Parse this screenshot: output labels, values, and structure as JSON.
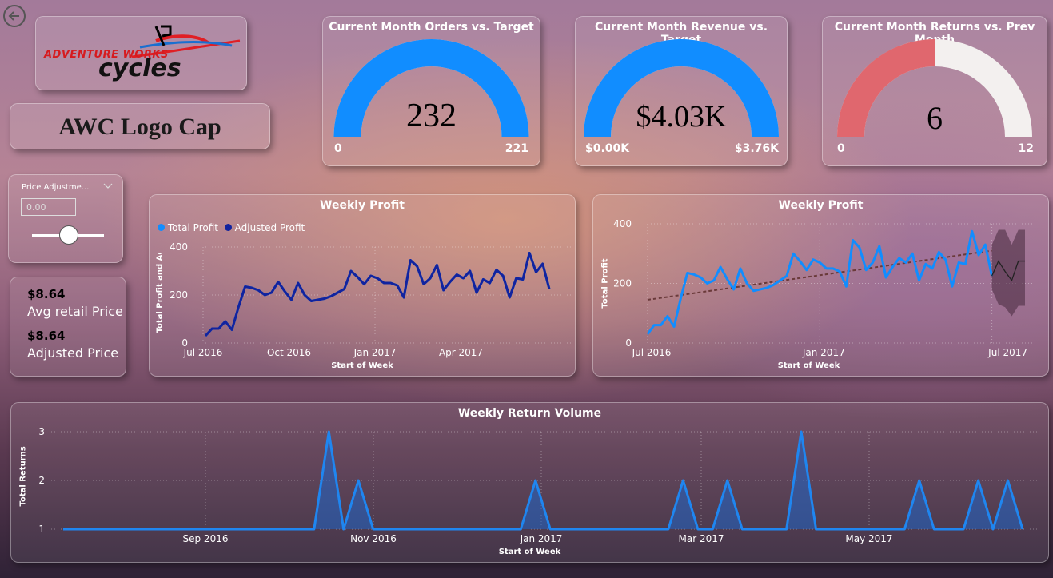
{
  "nav": {
    "back_icon": "back-arrow-icon"
  },
  "logo": {
    "line1": "ADVENTURE WORKS",
    "line2": "cycles"
  },
  "product": {
    "title": "AWC Logo Cap"
  },
  "slicer": {
    "label": "Price Adjustme...",
    "value": "0.00"
  },
  "kpi_card": {
    "avg_value": "$8.64",
    "avg_label": "Avg retail Price",
    "adj_value": "$8.64",
    "adj_label": "Adjusted Price"
  },
  "gauges": [
    {
      "title": "Current Month Orders vs. Target",
      "value_text": "232",
      "min": "0",
      "max": "221",
      "value": 232,
      "max_value": 221,
      "fill_color": "#118dff",
      "track_color": "#f3f0ef"
    },
    {
      "title": "Current Month Revenue vs. Target",
      "value_text": "$4.03K",
      "min": "$0.00K",
      "max": "$3.76K",
      "value": 4.03,
      "max_value": 3.76,
      "fill_color": "#118dff",
      "track_color": "#f3f0ef"
    },
    {
      "title": "Current Month Returns vs. Prev Month",
      "value_text": "6",
      "min": "0",
      "max": "12",
      "value": 6,
      "max_value": 12,
      "fill_color": "#e0676e",
      "track_color": "#f3f0ef"
    }
  ],
  "colors": {
    "total_profit": "#118dff",
    "adjusted_profit": "#12239e",
    "returns_line": "#1f86f0",
    "forecast": "#222222"
  },
  "chart_data": [
    {
      "type": "line",
      "title": "Weekly Profit",
      "xlabel": "Start of Week",
      "ylabel": "Total Profit and Adjuste...",
      "legend": "top-left",
      "series": [
        {
          "name": "Total Profit",
          "values": [
            30,
            60,
            60,
            90,
            55,
            150,
            235,
            230,
            220,
            200,
            210,
            255,
            215,
            180,
            250,
            200,
            175,
            180,
            185,
            195,
            210,
            225,
            300,
            275,
            245,
            280,
            270,
            250,
            250,
            240,
            190,
            345,
            320,
            245,
            270,
            325,
            220,
            255,
            285,
            270,
            300,
            210,
            265,
            250,
            305,
            280,
            190,
            270,
            265,
            375,
            295,
            330,
            225
          ]
        },
        {
          "name": "Adjusted Profit",
          "values": [
            30,
            60,
            60,
            90,
            55,
            150,
            235,
            230,
            220,
            200,
            210,
            255,
            215,
            180,
            250,
            200,
            175,
            180,
            185,
            195,
            210,
            225,
            300,
            275,
            245,
            280,
            270,
            250,
            250,
            240,
            190,
            345,
            320,
            245,
            270,
            325,
            220,
            255,
            285,
            270,
            300,
            210,
            265,
            250,
            305,
            280,
            190,
            270,
            265,
            375,
            295,
            330,
            225
          ]
        }
      ],
      "x_ticks": [
        "Jul 2016",
        "Oct 2016",
        "Jan 2017",
        "Apr 2017"
      ],
      "y_ticks": [
        0,
        200,
        400
      ],
      "ylim": [
        0,
        400
      ],
      "grid": true
    },
    {
      "type": "line",
      "title": "Weekly Profit",
      "xlabel": "Start of Week",
      "ylabel": "Total Profit",
      "series": [
        {
          "name": "Total Profit",
          "values": [
            30,
            60,
            60,
            90,
            55,
            150,
            235,
            230,
            220,
            200,
            210,
            255,
            215,
            180,
            250,
            200,
            175,
            180,
            185,
            195,
            210,
            225,
            300,
            275,
            245,
            280,
            270,
            250,
            250,
            240,
            190,
            345,
            320,
            245,
            270,
            325,
            220,
            255,
            285,
            270,
            300,
            210,
            265,
            250,
            305,
            280,
            190,
            270,
            265,
            375,
            295,
            330,
            225
          ]
        }
      ],
      "trend": [
        145,
        310
      ],
      "forecast": {
        "values": [
          225,
          275,
          240,
          210,
          275,
          275
        ],
        "upper": [
          330,
          380,
          380,
          330,
          380,
          380
        ],
        "lower": [
          180,
          130,
          120,
          90,
          125,
          125
        ]
      },
      "x_ticks": [
        "Jul 2016",
        "Jan 2017",
        "Jul 2017"
      ],
      "y_ticks": [
        0,
        200,
        400
      ],
      "ylim": [
        0,
        400
      ],
      "grid": true
    },
    {
      "type": "area",
      "title": "Weekly Return Volume",
      "xlabel": "Start of Week",
      "ylabel": "Total Returns",
      "series": [
        {
          "name": "Total Returns",
          "values": [
            1,
            1,
            1,
            1,
            1,
            1,
            1,
            1,
            1,
            1,
            1,
            1,
            1,
            1,
            1,
            1,
            1,
            1,
            3,
            1,
            2,
            1,
            1,
            1,
            1,
            1,
            1,
            1,
            1,
            1,
            1,
            1,
            2,
            1,
            1,
            1,
            1,
            1,
            1,
            1,
            1,
            1,
            2,
            1,
            1,
            2,
            1,
            1,
            1,
            1,
            3,
            1,
            1,
            1,
            1,
            1,
            1,
            1,
            2,
            1,
            1,
            1,
            2,
            1,
            2,
            1
          ]
        }
      ],
      "x_ticks": [
        "Sep 2016",
        "Nov 2016",
        "Jan 2017",
        "Mar 2017",
        "May 2017"
      ],
      "y_ticks": [
        1,
        2,
        3
      ],
      "ylim": [
        1,
        3
      ],
      "grid": true
    }
  ]
}
